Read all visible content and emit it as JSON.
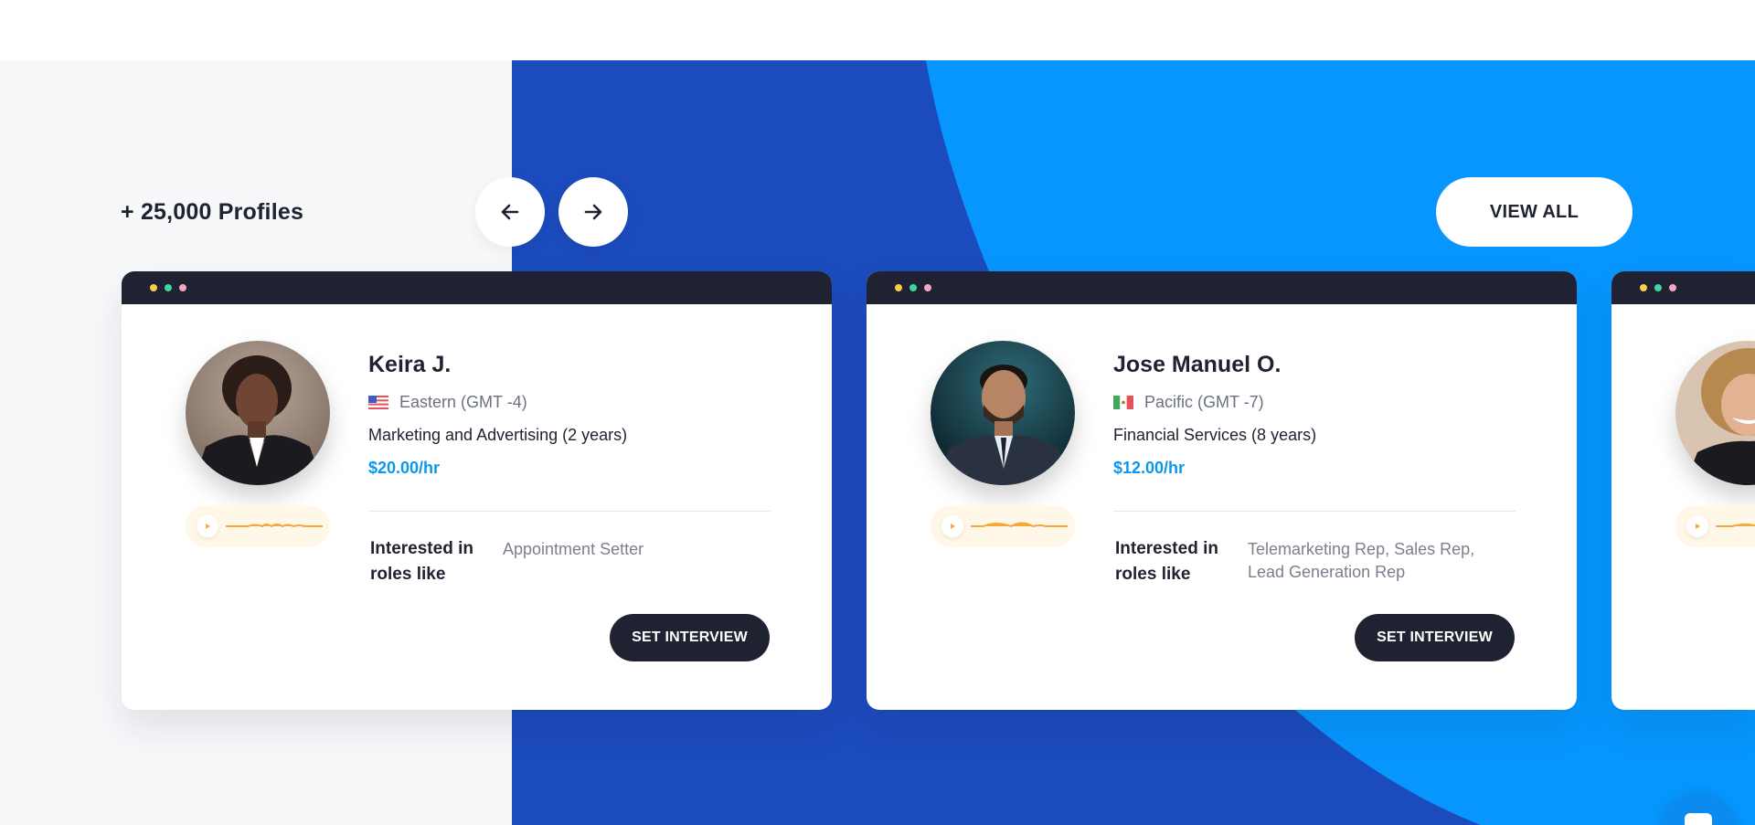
{
  "header": {
    "profiles_count": "+ 25,000 Profiles",
    "view_all_label": "VIEW ALL"
  },
  "colors": {
    "dark_navy": "#1f2230",
    "royal_blue": "#1c4bbd",
    "sky_blue": "#0796fe",
    "rate_blue": "#0b97ea",
    "page_bg": "#f7f8fa",
    "dot_yellow": "#f6cf4a",
    "dot_green": "#3dd6a0",
    "dot_pink": "#f7a4c0",
    "audio_wave": "#f5a93a"
  },
  "cards": [
    {
      "name": "Keira J.",
      "flag": "us-flag-icon",
      "timezone": "Eastern (GMT -4)",
      "industry": "Marketing and Advertising (2 years)",
      "rate": "$20.00/hr",
      "interested_label": "Interested in roles like",
      "roles": "Appointment Setter",
      "button_label": "SET INTERVIEW"
    },
    {
      "name": "Jose Manuel O.",
      "flag": "mexico-flag-icon",
      "timezone": "Pacific (GMT -7)",
      "industry": "Financial Services (8 years)",
      "rate": "$12.00/hr",
      "interested_label": "Interested in roles like",
      "roles": "Telemarketing Rep, Sales Rep, Lead Generation Rep",
      "button_label": "SET INTERVIEW"
    }
  ],
  "icons": {
    "prev": "arrow-left-icon",
    "next": "arrow-right-icon",
    "play": "play-icon",
    "chat": "chat-icon"
  }
}
